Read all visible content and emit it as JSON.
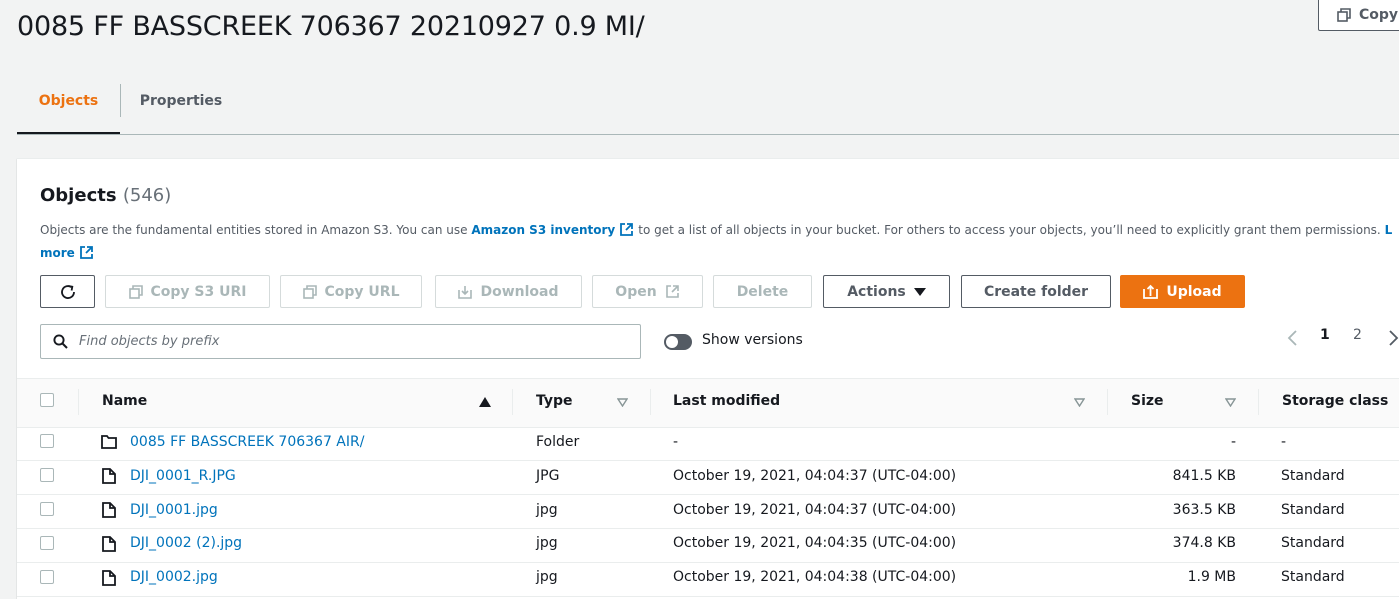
{
  "header": {
    "title": "0085 FF BASSCREEK 706367 20210927 0.9 MI/",
    "copy_label": "Copy"
  },
  "tabs": [
    {
      "label": "Objects",
      "active": true
    },
    {
      "label": "Properties",
      "active": false
    }
  ],
  "objects_panel": {
    "heading": "Objects",
    "count": "(546)",
    "description_before": "Objects are the fundamental entities stored in Amazon S3. You can use ",
    "inventory_link": "Amazon S3 inventory",
    "description_after": " to get a list of all objects in your bucket. For others to access your objects, you’ll need to explicitly grant them permissions. ",
    "learn_more_start": "L",
    "learn_more_end": "more"
  },
  "toolbar": {
    "refresh": "refresh",
    "copy_s3_uri": "Copy S3 URI",
    "copy_url": "Copy URL",
    "download": "Download",
    "open": "Open",
    "delete": "Delete",
    "actions": "Actions",
    "create_folder": "Create folder",
    "upload": "Upload"
  },
  "search": {
    "placeholder": "Find objects by prefix",
    "value": ""
  },
  "versions_toggle": {
    "label": "Show versions",
    "on": false
  },
  "pagination": {
    "pages": [
      "1",
      "2"
    ],
    "current": "1"
  },
  "table": {
    "columns": {
      "name": "Name",
      "type": "Type",
      "last_modified": "Last modified",
      "size": "Size",
      "storage_class": "Storage class"
    },
    "rows": [
      {
        "name": "0085 FF BASSCREEK 706367 AIR/",
        "kind": "folder",
        "type": "Folder",
        "last_modified": "-",
        "size": "-",
        "storage_class": "-"
      },
      {
        "name": "DJI_0001_R.JPG",
        "kind": "file",
        "type": "JPG",
        "last_modified": "October 19, 2021, 04:04:37 (UTC-04:00)",
        "size": "841.5 KB",
        "storage_class": "Standard"
      },
      {
        "name": "DJI_0001.jpg",
        "kind": "file",
        "type": "jpg",
        "last_modified": "October 19, 2021, 04:04:37 (UTC-04:00)",
        "size": "363.5 KB",
        "storage_class": "Standard"
      },
      {
        "name": "DJI_0002 (2).jpg",
        "kind": "file",
        "type": "jpg",
        "last_modified": "October 19, 2021, 04:04:35 (UTC-04:00)",
        "size": "374.8 KB",
        "storage_class": "Standard"
      },
      {
        "name": "DJI_0002.jpg",
        "kind": "file",
        "type": "jpg",
        "last_modified": "October 19, 2021, 04:04:38 (UTC-04:00)",
        "size": "1.9 MB",
        "storage_class": "Standard"
      }
    ]
  },
  "colors": {
    "accent": "#ec7211",
    "link": "#0073bb",
    "text": "#16191f",
    "secondary_text": "#545b64",
    "disabled": "#aab7b8"
  }
}
